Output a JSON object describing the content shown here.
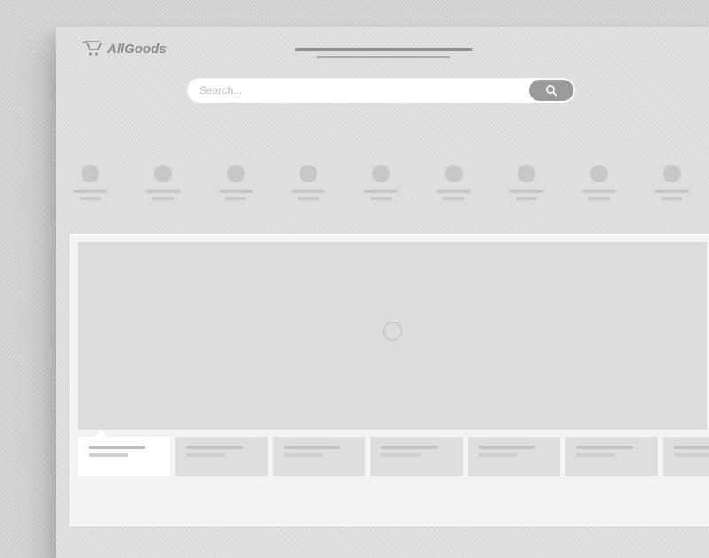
{
  "brand": {
    "name": "AllGoods"
  },
  "search": {
    "placeholder": "Search..."
  },
  "categories": [
    {},
    {},
    {},
    {},
    {},
    {},
    {},
    {},
    {},
    {}
  ],
  "hero_tabs": [
    {
      "active": true
    },
    {
      "active": false
    },
    {
      "active": false
    },
    {
      "active": false
    },
    {
      "active": false
    },
    {
      "active": false
    },
    {
      "active": false
    }
  ]
}
